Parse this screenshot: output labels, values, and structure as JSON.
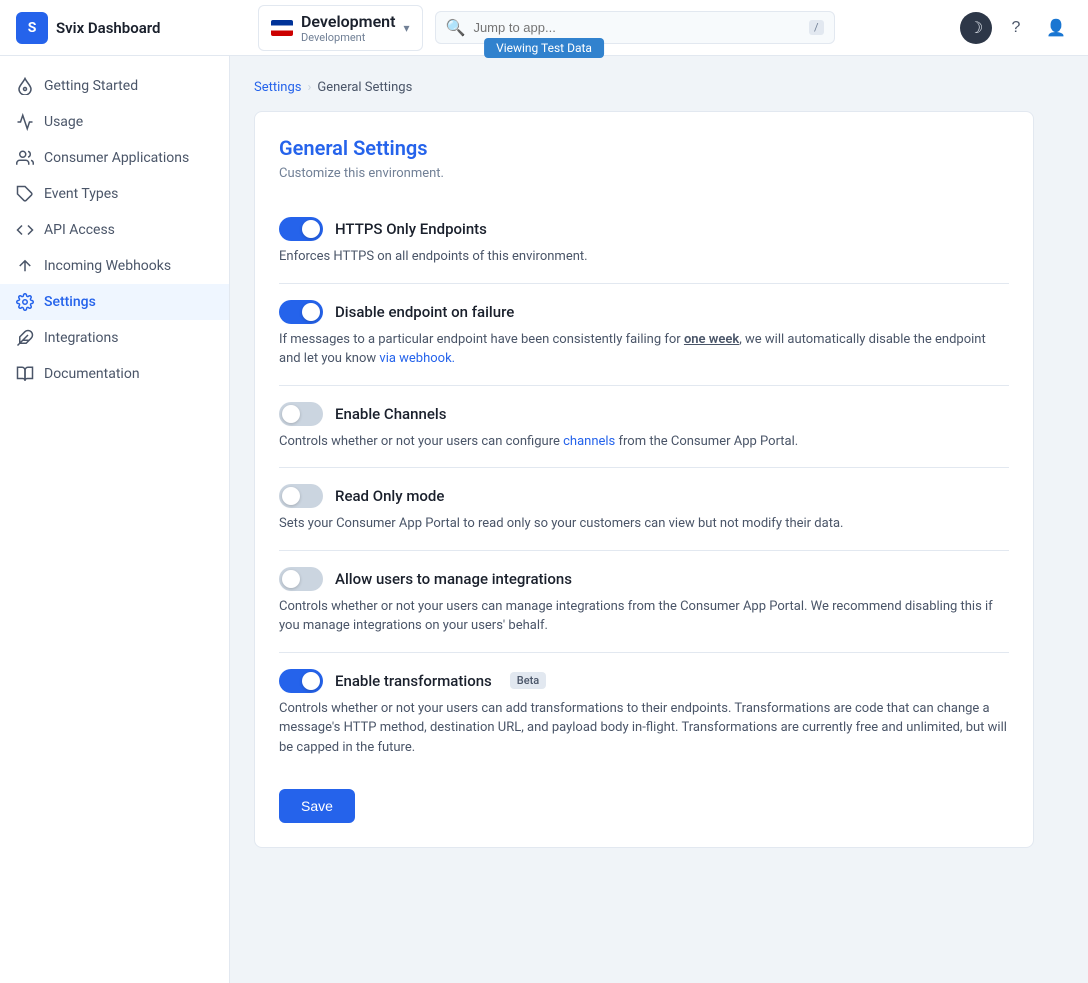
{
  "brand": {
    "logo_text": "S",
    "name": "Svix Dashboard"
  },
  "navbar": {
    "env_name": "Development",
    "env_sub": "Development",
    "search_placeholder": "Jump to app...",
    "search_shortcut": "/",
    "viewing_test_data": "Viewing Test Data"
  },
  "sidebar": {
    "items": [
      {
        "id": "getting-started",
        "label": "Getting Started",
        "icon": "rocket"
      },
      {
        "id": "usage",
        "label": "Usage",
        "icon": "chart"
      },
      {
        "id": "consumer-applications",
        "label": "Consumer Applications",
        "icon": "users"
      },
      {
        "id": "event-types",
        "label": "Event Types",
        "icon": "tag"
      },
      {
        "id": "api-access",
        "label": "API Access",
        "icon": "code"
      },
      {
        "id": "incoming-webhooks",
        "label": "Incoming Webhooks",
        "icon": "webhook"
      },
      {
        "id": "settings",
        "label": "Settings",
        "icon": "gear",
        "active": true
      },
      {
        "id": "integrations",
        "label": "Integrations",
        "icon": "puzzle"
      },
      {
        "id": "documentation",
        "label": "Documentation",
        "icon": "book"
      }
    ]
  },
  "breadcrumb": {
    "parent": "Settings",
    "current": "General Settings"
  },
  "page": {
    "title": "General Settings",
    "subtitle": "Customize this environment.",
    "settings": [
      {
        "id": "https-only",
        "name": "HTTPS Only Endpoints",
        "enabled": true,
        "description": "Enforces HTTPS on all endpoints of this environment.",
        "has_link": false
      },
      {
        "id": "disable-on-failure",
        "name": "Disable endpoint on failure",
        "enabled": true,
        "description_parts": [
          {
            "type": "text",
            "text": "If messages to a particular endpoint have been consistently failing for "
          },
          {
            "type": "bold",
            "text": "one week"
          },
          {
            "type": "text",
            "text": ", we will automatically disable the endpoint and let you know "
          },
          {
            "type": "link",
            "text": "via webhook."
          }
        ]
      },
      {
        "id": "enable-channels",
        "name": "Enable Channels",
        "enabled": false,
        "description_parts": [
          {
            "type": "text",
            "text": "Controls whether or not your users can configure "
          },
          {
            "type": "link",
            "text": "channels"
          },
          {
            "type": "text",
            "text": " from the Consumer App Portal."
          }
        ]
      },
      {
        "id": "read-only-mode",
        "name": "Read Only mode",
        "enabled": false,
        "description": "Sets your Consumer App Portal to read only so your customers can view but not modify their data."
      },
      {
        "id": "allow-manage-integrations",
        "name": "Allow users to manage integrations",
        "enabled": false,
        "description": "Controls whether or not your users can manage integrations from the Consumer App Portal. We recommend disabling this if you manage integrations on your users' behalf."
      },
      {
        "id": "enable-transformations",
        "name": "Enable transformations",
        "enabled": true,
        "beta": true,
        "description": "Controls whether or not your users can add transformations to their endpoints. Transformations are code that can change a message's HTTP method, destination URL, and payload body in-flight. Transformations are currently free and unlimited, but will be capped in the future."
      }
    ],
    "save_label": "Save",
    "beta_label": "Beta"
  }
}
